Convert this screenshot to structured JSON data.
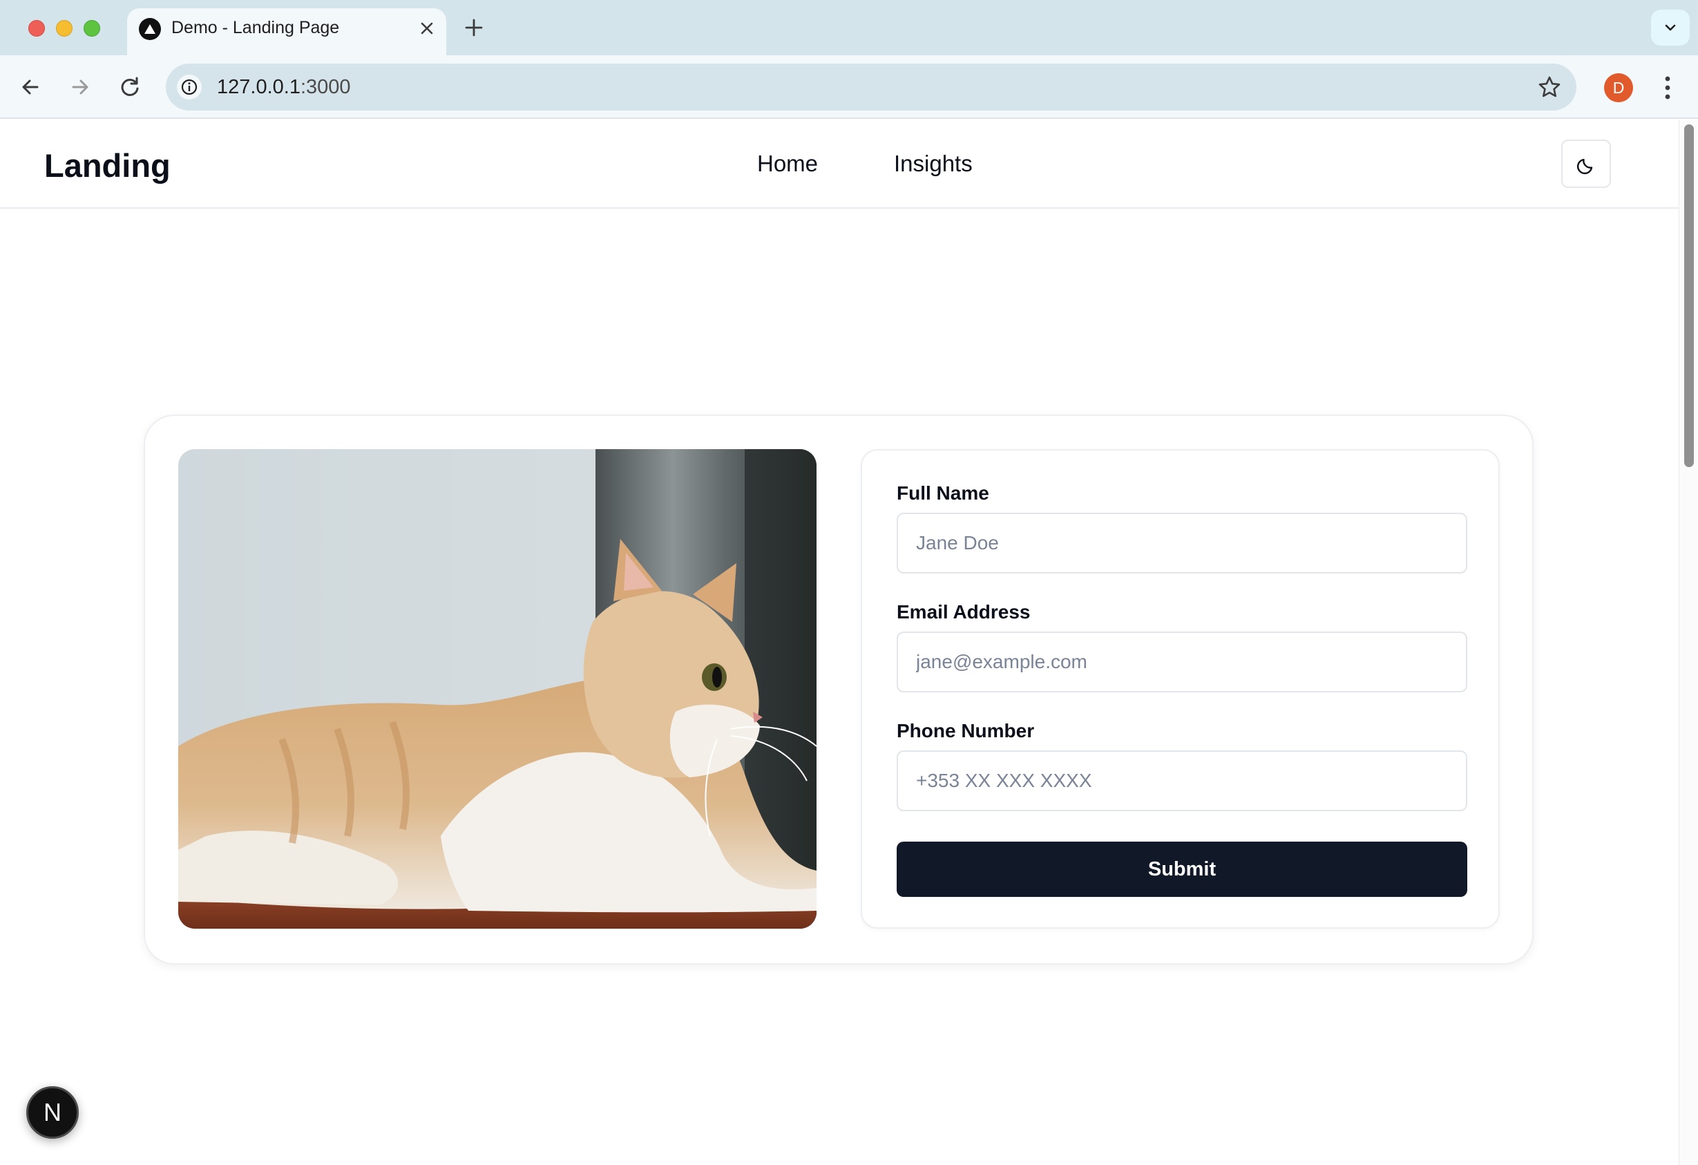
{
  "browser": {
    "tab_title": "Demo - Landing Page",
    "url_host": "127.0.0.1",
    "url_port": ":3000",
    "profile_initial": "D"
  },
  "site": {
    "brand": "Landing",
    "nav": [
      {
        "label": "Home"
      },
      {
        "label": "Insights"
      }
    ],
    "theme_toggle_icon": "moon-icon"
  },
  "hero": {
    "image": {
      "subject": "cat"
    },
    "form": {
      "full_name": {
        "label": "Full Name",
        "placeholder": "Jane Doe"
      },
      "email": {
        "label": "Email Address",
        "placeholder": "jane@example.com"
      },
      "phone": {
        "label": "Phone Number",
        "placeholder": "+353 XX XXX XXXX"
      },
      "submit_label": "Submit"
    }
  },
  "dev_badge": {
    "label": "N"
  },
  "colors": {
    "primary_button": "#111827",
    "profile_avatar": "#e05a2b",
    "tab_strip": "#d3e4ea"
  }
}
